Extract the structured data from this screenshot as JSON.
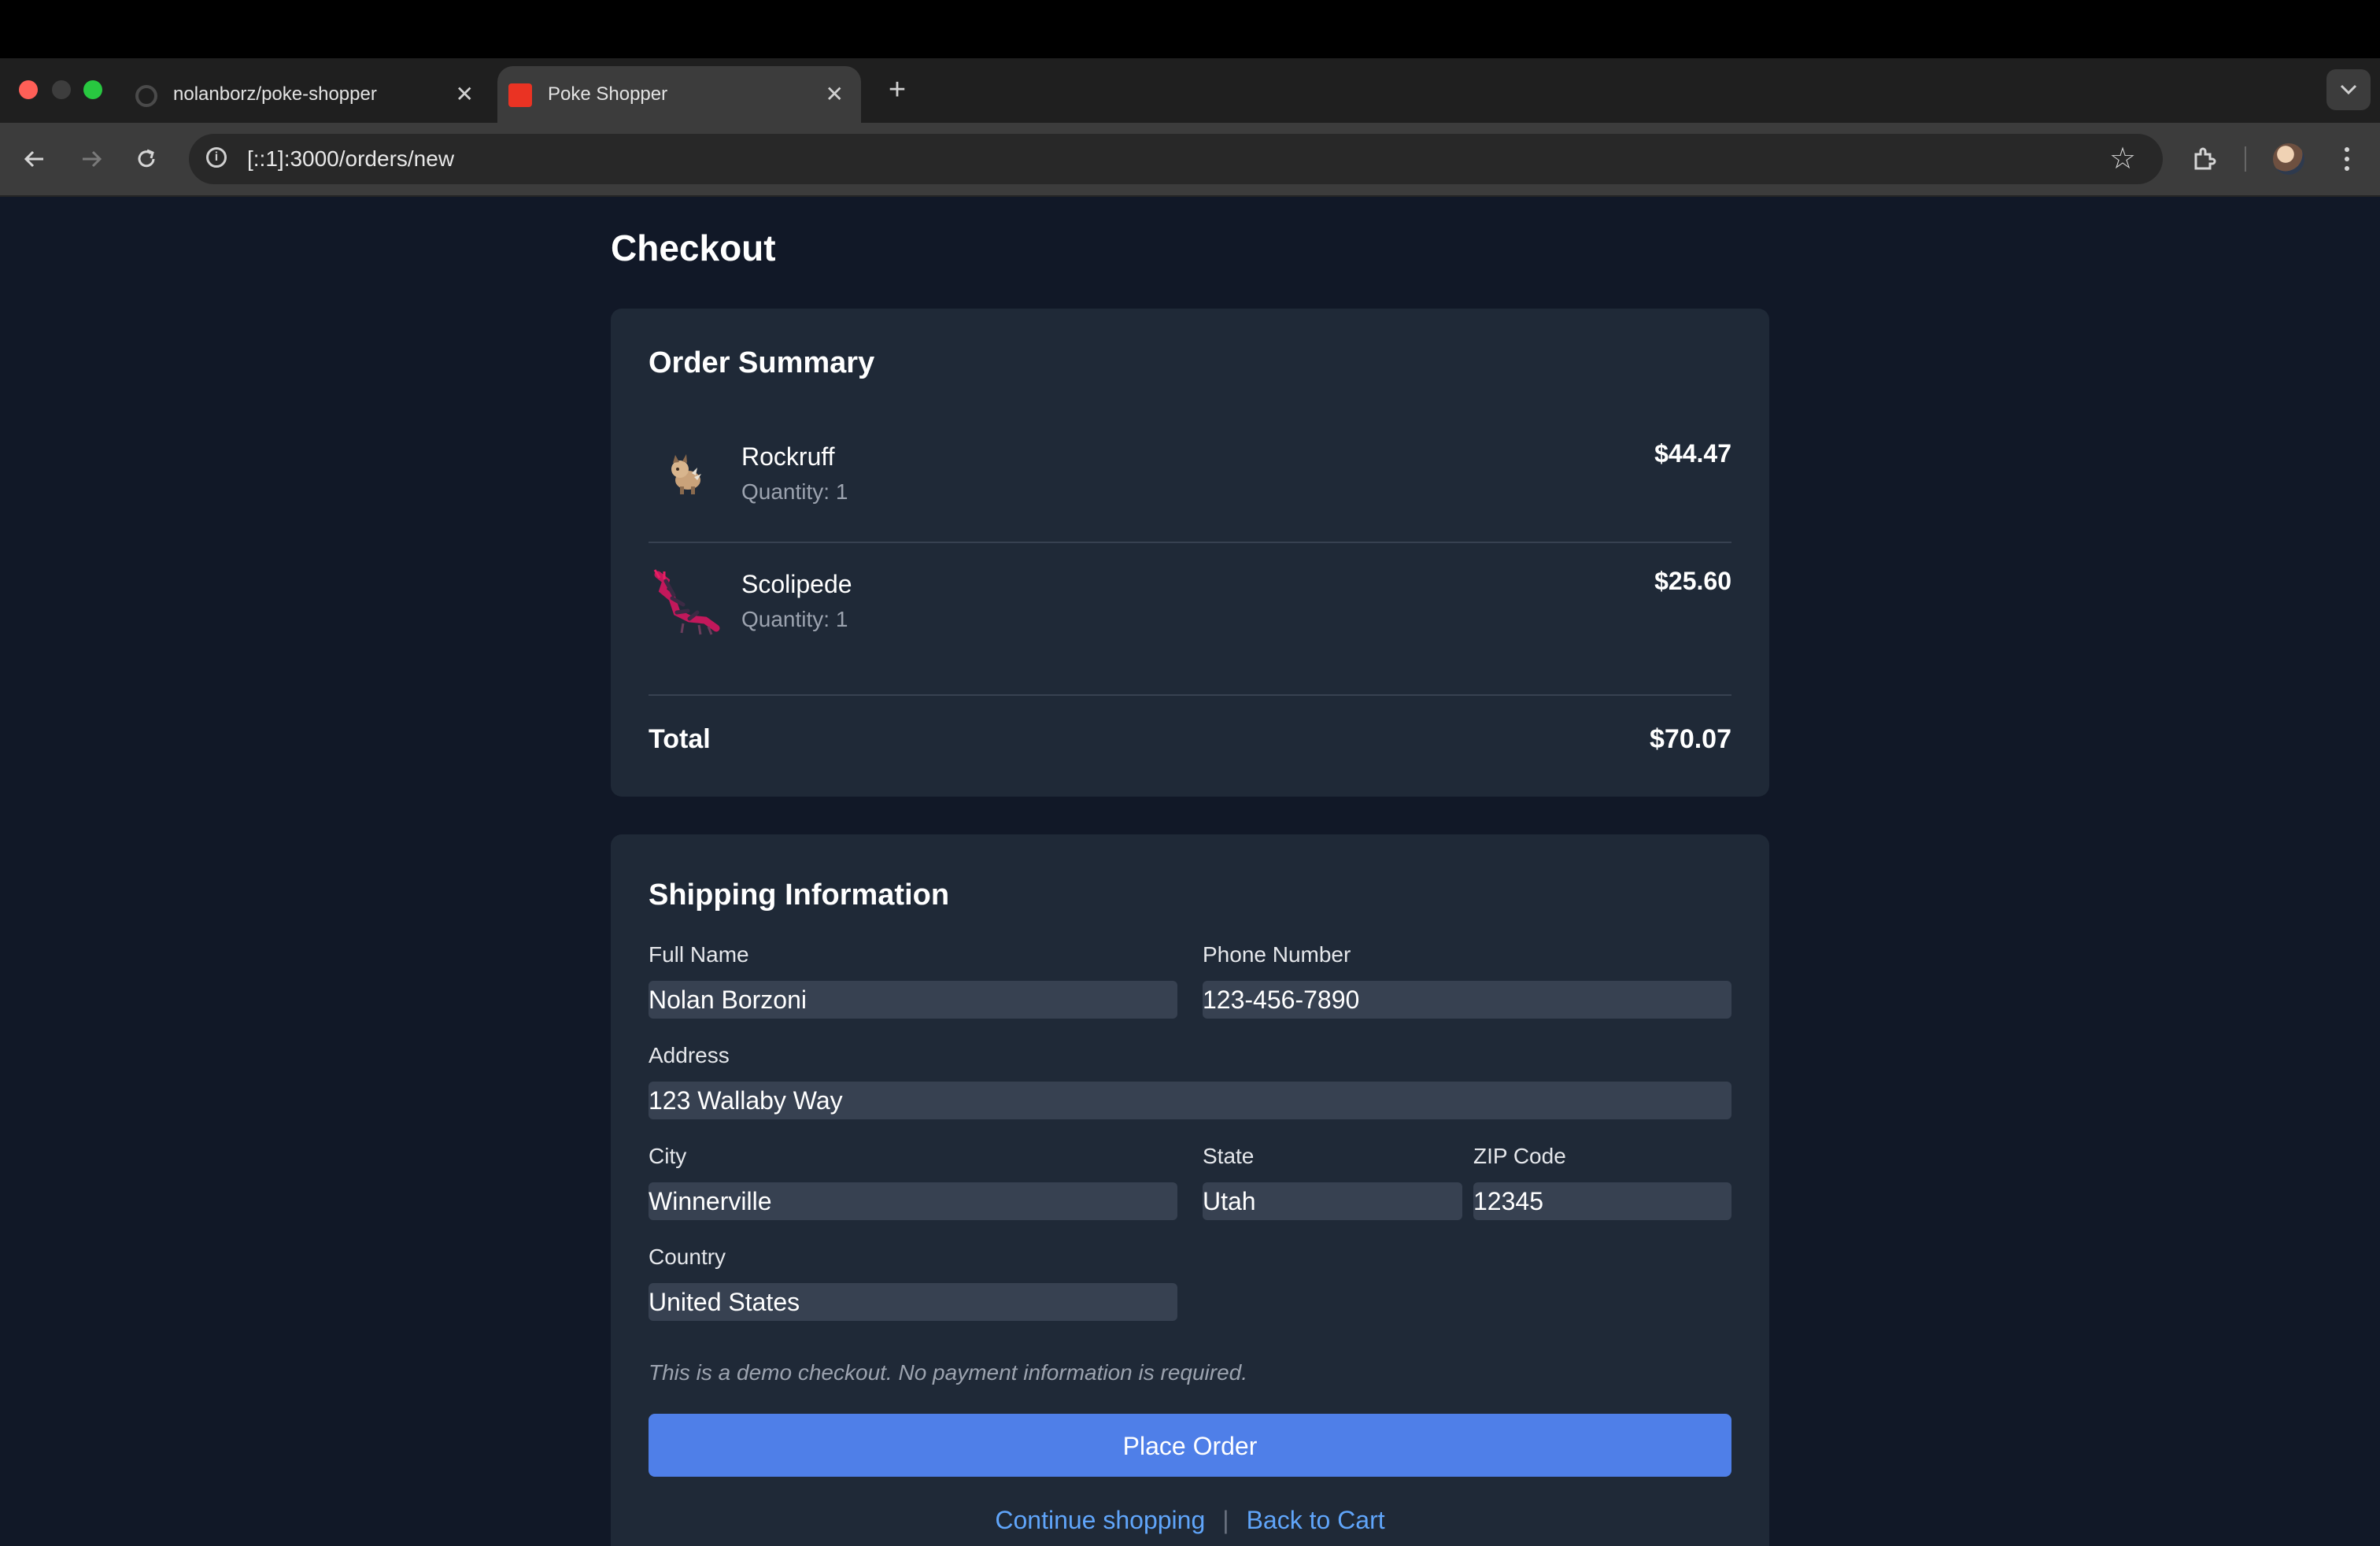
{
  "browser": {
    "tabs": [
      {
        "title": "nolanborz/poke-shopper",
        "favicon": "github-icon"
      },
      {
        "title": "Poke Shopper",
        "favicon": "app-favicon",
        "active": true
      }
    ],
    "close_glyph": "✕",
    "new_tab_glyph": "+",
    "url": "[::1]:3000/orders/new",
    "icons": [
      "back-arrow-icon",
      "forward-arrow-icon",
      "reload-icon",
      "site-info-icon",
      "bookmark-star-icon",
      "extensions-icon",
      "profile-avatar",
      "more-menu-icon"
    ]
  },
  "page": {
    "title": "Checkout"
  },
  "order_summary": {
    "heading": "Order Summary",
    "items": [
      {
        "name": "Rockruff",
        "quantity": "Quantity: 1",
        "price": "$44.47"
      },
      {
        "name": "Scolipede",
        "quantity": "Quantity: 1",
        "price": "$25.60"
      }
    ],
    "total_label": "Total",
    "total_value": "$70.07"
  },
  "shipping": {
    "heading": "Shipping Information",
    "fields": {
      "full_name": {
        "label": "Full Name",
        "value": "Nolan Borzoni"
      },
      "phone": {
        "label": "Phone Number",
        "value": "123-456-7890"
      },
      "address": {
        "label": "Address",
        "value": "123 Wallaby Way"
      },
      "city": {
        "label": "City",
        "value": "Winnerville"
      },
      "state": {
        "label": "State",
        "value": "Utah"
      },
      "zip": {
        "label": "ZIP Code",
        "value": "12345"
      },
      "country": {
        "label": "Country",
        "value": "United States"
      }
    },
    "note": "This is a demo checkout. No payment information is required.",
    "submit_label": "Place Order",
    "continue_link": "Continue shopping",
    "separator": "|",
    "back_link": "Back to Cart"
  },
  "colors": {
    "page_bg": "#111827",
    "card_bg": "#1f2937",
    "input_bg": "#374151",
    "accent_button": "#4f7fe8",
    "link": "#60a5fa"
  }
}
